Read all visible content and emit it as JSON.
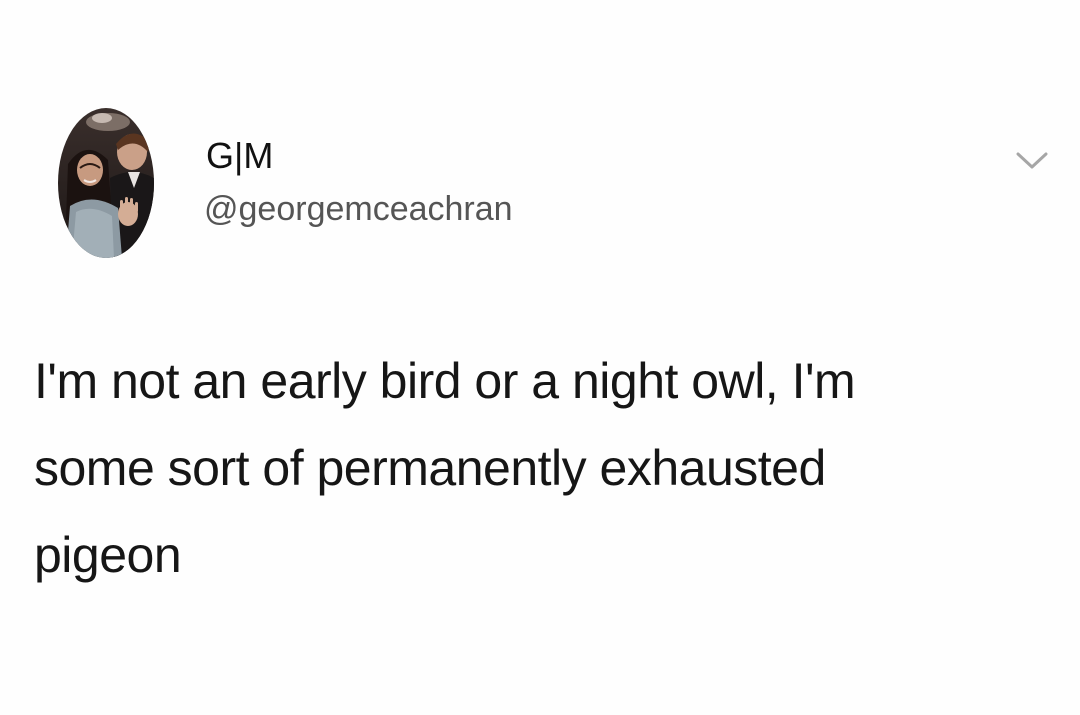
{
  "tweet": {
    "author": {
      "display_name": "G|M",
      "handle": "@georgemceachran",
      "avatar_icon": "profile-photo"
    },
    "menu_icon": "chevron-down-icon",
    "text_lines": [
      "I'm not an early bird or a night owl, I'm",
      "some sort of permanently exhausted",
      "pigeon"
    ]
  },
  "colors": {
    "background": "#fefefe",
    "text": "#161616",
    "handle": "#555555",
    "caret": "#a6a6a6"
  }
}
